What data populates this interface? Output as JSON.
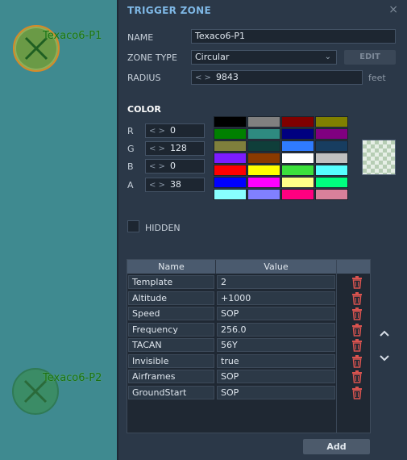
{
  "map": {
    "zones": [
      {
        "label": "Texaco6-P1"
      },
      {
        "label": "Texaco6-P2"
      }
    ]
  },
  "panel": {
    "title": "TRIGGER ZONE",
    "close_icon": "×",
    "name_label": "NAME",
    "name_value": "Texaco6-P1",
    "zone_type_label": "ZONE TYPE",
    "zone_type_value": "Circular",
    "edit_label": "EDIT",
    "radius_label": "RADIUS",
    "radius_value": "9843",
    "radius_unit": "feet",
    "spinner_glyph": "< >"
  },
  "color": {
    "title": "COLOR",
    "channels": [
      {
        "label": "R",
        "value": "0"
      },
      {
        "label": "G",
        "value": "128"
      },
      {
        "label": "B",
        "value": "0"
      },
      {
        "label": "A",
        "value": "38"
      }
    ],
    "palette": [
      "#000000",
      "#808080",
      "#800000",
      "#808000",
      "#008000",
      "#2e8a80",
      "#000080",
      "#800080",
      "#7f7f3c",
      "#0f3e3a",
      "#2f7bff",
      "#173d60",
      "#7c1cff",
      "#8a3a00",
      "#ffffff",
      "#c0c0c0",
      "#ff0000",
      "#ffff00",
      "#3ce03c",
      "#55ffff",
      "#0000ff",
      "#ff00ff",
      "#ffff88",
      "#00ff7f",
      "#88ffff",
      "#8080ff",
      "#ff0080",
      "#d8809a"
    ],
    "preview_color": "#008000"
  },
  "hidden": {
    "label": "HIDDEN",
    "checked": false
  },
  "properties": {
    "headers": [
      "Name",
      "Value"
    ],
    "rows": [
      {
        "name": "Template",
        "value": "2"
      },
      {
        "name": "Altitude",
        "value": "+1000"
      },
      {
        "name": "Speed",
        "value": "SOP"
      },
      {
        "name": "Frequency",
        "value": "256.0"
      },
      {
        "name": "TACAN",
        "value": "56Y"
      },
      {
        "name": "Invisible",
        "value": "true"
      },
      {
        "name": "Airframes",
        "value": "SOP"
      },
      {
        "name": "GroundStart",
        "value": "SOP"
      }
    ],
    "delete_icon": "trash-icon",
    "add_label": "Add"
  },
  "colors": {
    "accent": "#7fb8e6",
    "delete": "#d9534f",
    "map_bg": "#3f8a90"
  }
}
